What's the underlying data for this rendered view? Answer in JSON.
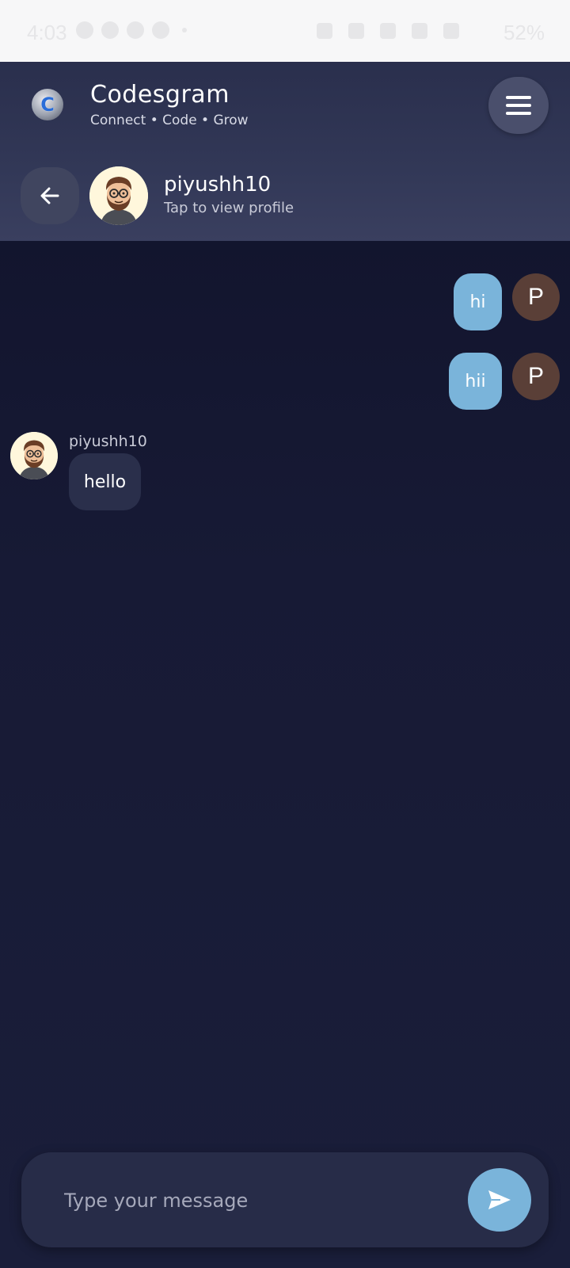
{
  "status_bar": {
    "time": "4:03",
    "battery": "52%"
  },
  "header": {
    "app_title": "Codesgram",
    "app_subtitle": "Connect • Code • Grow",
    "logo_letter": "C"
  },
  "conversation": {
    "contact_name": "piyushh10",
    "contact_subtitle": "Tap to view profile"
  },
  "messages": [
    {
      "direction": "outgoing",
      "text": "hi",
      "avatar_letter": "P"
    },
    {
      "direction": "outgoing",
      "text": "hii",
      "avatar_letter": "P"
    },
    {
      "direction": "incoming",
      "sender": "piyushh10",
      "text": "hello"
    }
  ],
  "composer": {
    "placeholder": "Type your message"
  },
  "colors": {
    "outgoing_bubble": "#7ab4da",
    "incoming_bubble": "#2a2f4b",
    "sender_avatar": "#5a3f37",
    "background": "#171a35"
  }
}
